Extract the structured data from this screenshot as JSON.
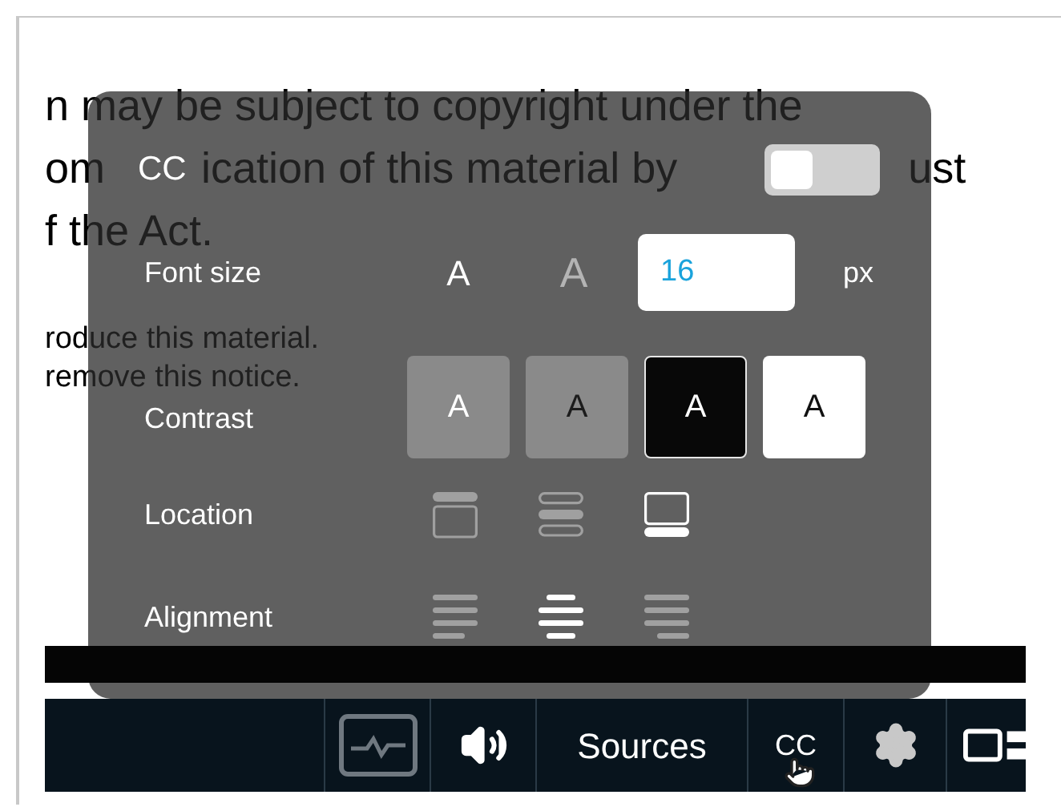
{
  "document": {
    "lines": [
      {
        "parts": [
          "n may be subject to copyright under the"
        ]
      },
      {
        "parts": [
          "om",
          "ication of this material by",
          "ust"
        ]
      },
      {
        "parts": [
          "f the Act."
        ]
      }
    ],
    "small_lines": [
      "roduce this material.",
      "remove this notice."
    ]
  },
  "cc_panel": {
    "title": "CC",
    "toggle": {
      "on": false
    },
    "font_size": {
      "label": "Font size",
      "decrease": "A",
      "increase": "A",
      "value": "16",
      "unit": "px"
    },
    "contrast": {
      "label": "Contrast",
      "options": [
        {
          "kind": "gray-light",
          "text": "A",
          "selected": false
        },
        {
          "kind": "gray-dark",
          "text": "A",
          "selected": false
        },
        {
          "kind": "black",
          "text": "A",
          "selected": true
        },
        {
          "kind": "white",
          "text": "A",
          "selected": false
        }
      ]
    },
    "location": {
      "label": "Location",
      "options": [
        {
          "kind": "top",
          "selected": false
        },
        {
          "kind": "middle",
          "selected": false
        },
        {
          "kind": "bottom",
          "selected": true
        }
      ]
    },
    "alignment": {
      "label": "Alignment",
      "options": [
        {
          "kind": "left",
          "selected": false
        },
        {
          "kind": "center",
          "selected": true
        },
        {
          "kind": "right",
          "selected": false
        }
      ]
    }
  },
  "controls": {
    "buttons": [
      {
        "kind": "activity"
      },
      {
        "kind": "volume"
      },
      {
        "kind": "text",
        "label": "Sources"
      },
      {
        "kind": "cc",
        "label": "CC"
      },
      {
        "kind": "gear"
      },
      {
        "kind": "layout"
      }
    ]
  }
}
